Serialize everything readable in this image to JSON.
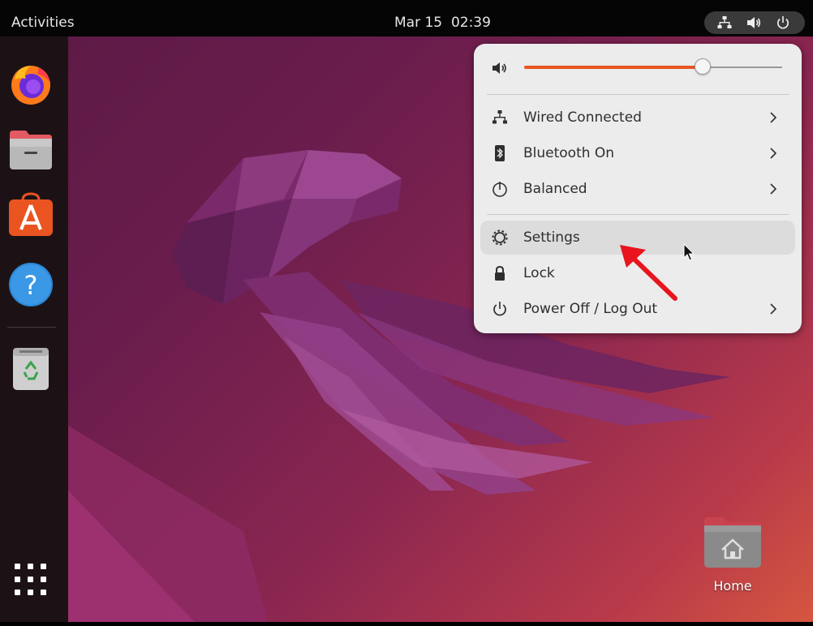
{
  "topbar": {
    "activities_label": "Activities",
    "clock_date": "Mar 15",
    "clock_time": "02:39",
    "indicators": [
      "network-wired-icon",
      "volume-icon",
      "power-icon"
    ]
  },
  "dock": {
    "apps": [
      {
        "name": "Firefox",
        "icon": "firefox-icon"
      },
      {
        "name": "Files",
        "icon": "files-icon"
      },
      {
        "name": "Ubuntu Software",
        "icon": "software-store-icon"
      },
      {
        "name": "Help",
        "icon": "help-icon"
      },
      {
        "name": "Trash",
        "icon": "trash-icon"
      }
    ],
    "show_apps_icon": "app-grid-icon"
  },
  "desktop": {
    "home_label": "Home"
  },
  "quick_settings": {
    "volume": {
      "level": 0.69,
      "icon": "volume-icon"
    },
    "items": [
      {
        "label": "Wired Connected",
        "icon": "network-wired-icon",
        "submenu": true
      },
      {
        "label": "Bluetooth On",
        "icon": "bluetooth-icon",
        "submenu": true
      },
      {
        "label": "Balanced",
        "icon": "power-profile-icon",
        "submenu": true
      },
      {
        "label": "Settings",
        "icon": "gear-icon",
        "submenu": false,
        "highlighted": true
      },
      {
        "label": "Lock",
        "icon": "lock-icon",
        "submenu": false
      },
      {
        "label": "Power Off / Log Out",
        "icon": "power-icon",
        "submenu": true
      }
    ]
  },
  "colors": {
    "accent": "#e95420",
    "menu_bg": "#ececec",
    "topbar_bg": "#050505",
    "dock_bg": "#1c1216",
    "annotation_arrow": "#e8141e"
  }
}
